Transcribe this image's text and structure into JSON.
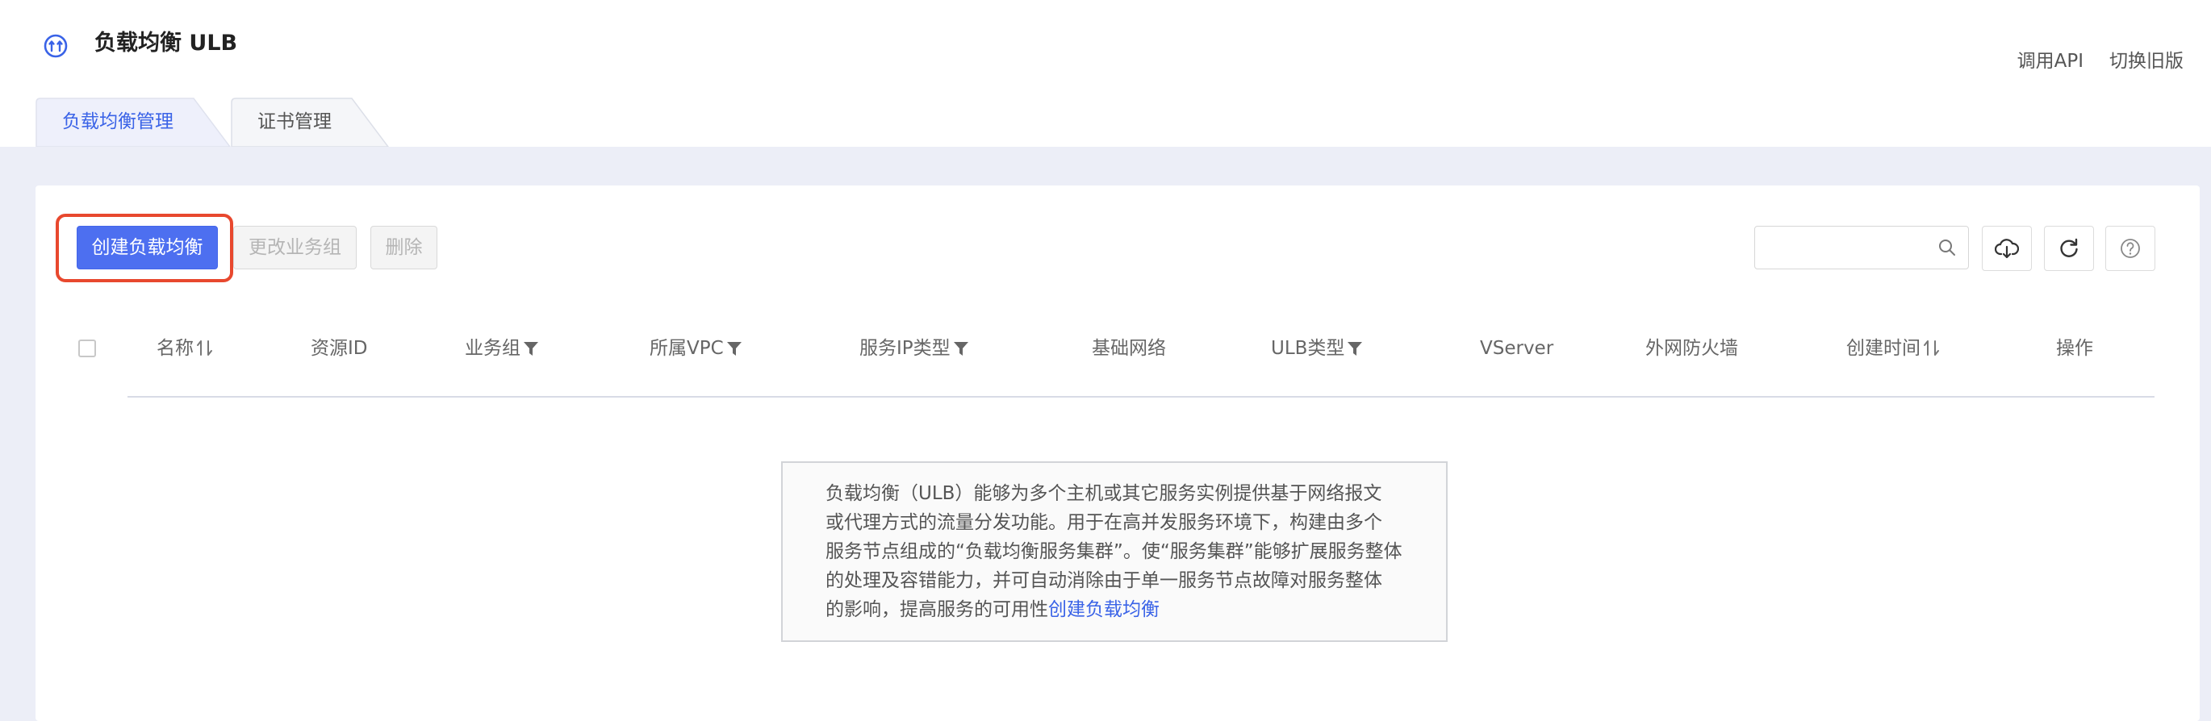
{
  "header": {
    "title": "负载均衡 ULB",
    "logo_icon": "ulb-icon",
    "links": [
      "调用API",
      "切换旧版"
    ]
  },
  "tabs": [
    {
      "label": "负载均衡管理",
      "active": true
    },
    {
      "label": "证书管理",
      "active": false
    }
  ],
  "toolbar": {
    "create_label": "创建负载均衡",
    "change_group_label": "更改业务组",
    "delete_label": "删除",
    "search_placeholder": "",
    "icons": [
      "cloud-download-icon",
      "refresh-icon",
      "help-icon"
    ]
  },
  "table": {
    "columns": [
      {
        "label": "名称",
        "icon": "sort-icon"
      },
      {
        "label": "资源ID",
        "icon": ""
      },
      {
        "label": "业务组",
        "icon": "filter-icon"
      },
      {
        "label": "所属VPC",
        "icon": "filter-icon"
      },
      {
        "label": "服务IP类型",
        "icon": "filter-icon"
      },
      {
        "label": "基础网络",
        "icon": ""
      },
      {
        "label": "ULB类型",
        "icon": "filter-icon"
      },
      {
        "label": "VServer",
        "icon": ""
      },
      {
        "label": "外网防火墙",
        "icon": ""
      },
      {
        "label": "创建时间",
        "icon": "sort-icon"
      },
      {
        "label": "操作",
        "icon": ""
      }
    ]
  },
  "empty_state": {
    "line1": "负载均衡（ULB）能够为多个主机或其它服务实例提供基于网络报文",
    "line2": "或代理方式的流量分发功能。用于在高并发服务环境下，构建由多个",
    "line3": "服务节点组成的“负载均衡服务集群”。使“服务集群”能够扩展服务整体",
    "line4": "的处理及容错能力，并可自动消除由于单一服务节点故障对服务整体",
    "line5": "的影响，提高服务的可用性",
    "link": "创建负载均衡"
  },
  "colors": {
    "primary": "#4d6ff0",
    "link": "#3a63e7",
    "highlight": "#e8482e",
    "page_bg": "#eceef7"
  }
}
